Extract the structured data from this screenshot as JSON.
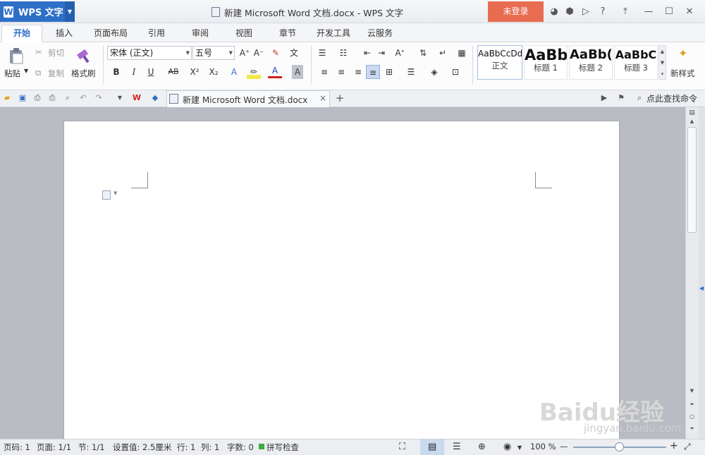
{
  "app": {
    "name": "WPS 文字",
    "title": "新建 Microsoft Word 文档.docx - WPS 文字",
    "login": "未登录"
  },
  "tabs": [
    "开始",
    "插入",
    "页面布局",
    "引用",
    "审阅",
    "视图",
    "章节",
    "开发工具",
    "云服务"
  ],
  "ribbon": {
    "paste": "粘贴",
    "cut": "剪切",
    "copy": "复制",
    "format_painter": "格式刷",
    "font_name": "宋体 (正文)",
    "font_size": "五号",
    "bold": "B",
    "italic": "I",
    "underline": "U",
    "strike": "AB",
    "superscript": "X²",
    "subscript": "X₂",
    "styles": [
      {
        "sample": "AaBbCcDd",
        "name": "正文"
      },
      {
        "sample": "AaBb",
        "name": "标题 1"
      },
      {
        "sample": "AaBb(",
        "name": "标题 2"
      },
      {
        "sample": "AaBbC",
        "name": "标题 3"
      }
    ],
    "new_style": "新样式"
  },
  "doc_tab": {
    "label": "新建 Microsoft Word 文档.docx",
    "close": "×",
    "add": "+"
  },
  "search": {
    "label": "点此查找命令"
  },
  "status": {
    "page_no": "页码: 1",
    "pages": "页面: 1/1",
    "section": "节: 1/1",
    "setting": "设置值: 2.5厘米",
    "row": "行: 1",
    "col": "列: 1",
    "words": "字数: 0",
    "spellcheck": "拼写检查",
    "zoom": "100 %"
  },
  "watermark": {
    "brand": "Baidu经验",
    "url": "jingyan.baidu.com"
  }
}
